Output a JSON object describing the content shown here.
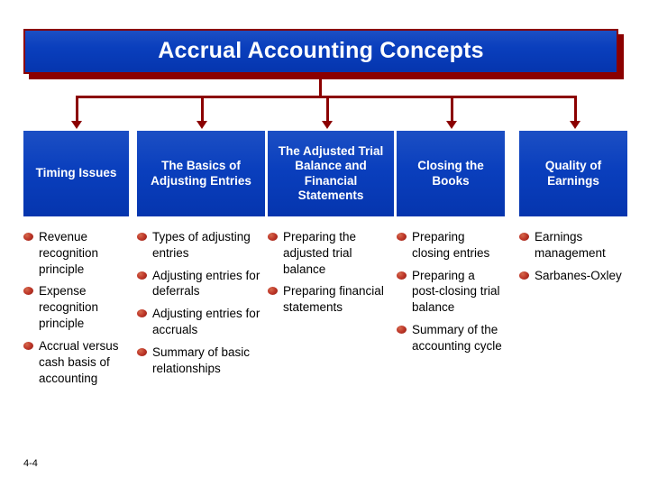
{
  "title": "Accrual Accounting Concepts",
  "slide_number": "4-4",
  "colors": {
    "header_blue": "#0a3fbd",
    "connector_dark_red": "#8b0000",
    "bullet_red": "#c0392b",
    "text_white": "#ffffff",
    "body_text": "#000000"
  },
  "columns": [
    {
      "header": "Timing Issues",
      "items": [
        "Revenue recognition principle",
        "Expense recognition principle",
        "Accrual versus cash basis of accounting"
      ]
    },
    {
      "header": "The Basics of Adjusting Entries",
      "items": [
        "Types of adjusting entries",
        "Adjusting entries for deferrals",
        "Adjusting entries for accruals",
        "Summary of basic relationships"
      ]
    },
    {
      "header": "The Adjusted Trial Balance and Financial Statements",
      "items": [
        "Preparing the adjusted trial balance",
        "Preparing financial statements"
      ]
    },
    {
      "header": "Closing the Books",
      "items": [
        "Preparing closing entries",
        "Preparing a post-closing trial balance",
        "Summary of the accounting cycle"
      ]
    },
    {
      "header": "Quality of Earnings",
      "items": [
        "Earnings management",
        "Sarbanes-Oxley"
      ]
    }
  ]
}
